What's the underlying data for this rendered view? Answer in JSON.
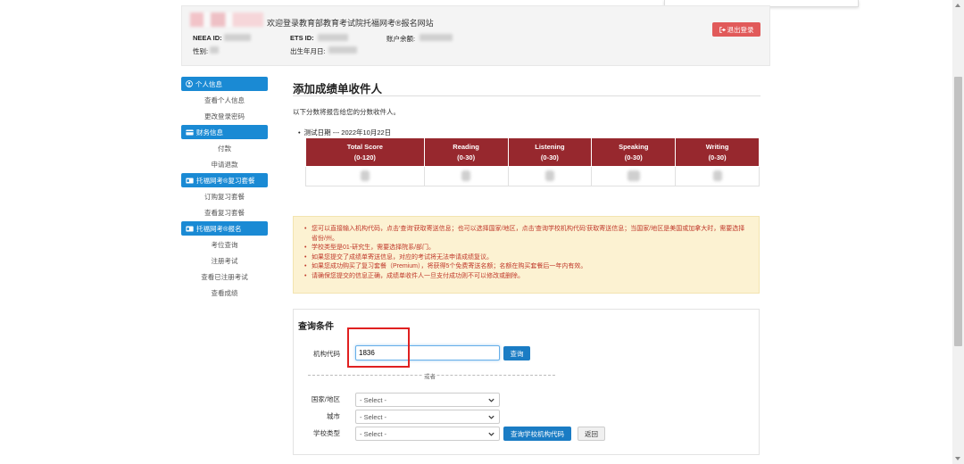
{
  "header": {
    "welcome": "欢迎登录教育部教育考试院托福网考®报名网站",
    "neea_id_label": "NEEA ID:",
    "ets_id_label": "ETS ID:",
    "balance_label": "账户余额:",
    "gender_label": "性别:",
    "dob_label": "出生年月日:",
    "logout_label": "退出登录"
  },
  "sidebar": {
    "sections": [
      {
        "title": "个人信息",
        "items": [
          "查看个人信息",
          "更改登录密码"
        ]
      },
      {
        "title": "财务信息",
        "items": [
          "付款",
          "申请退款"
        ]
      },
      {
        "title": "托福网考®复习套餐",
        "items": [
          "订购复习套餐",
          "查看复习套餐"
        ]
      },
      {
        "title": "托福网考®报名",
        "items": [
          "考位查询",
          "注册考试",
          "查看已注册考试",
          "查看成绩"
        ]
      }
    ]
  },
  "main": {
    "title": "添加成绩单收件人",
    "intro": "以下分数将报告给您的分数收件人。",
    "test_date": "测试日期 --- 2022年10月22日",
    "score_headers": [
      {
        "name": "Total Score",
        "range": "(0-120)"
      },
      {
        "name": "Reading",
        "range": "(0-30)"
      },
      {
        "name": "Listening",
        "range": "(0-30)"
      },
      {
        "name": "Speaking",
        "range": "(0-30)"
      },
      {
        "name": "Writing",
        "range": "(0-30)"
      }
    ],
    "notices": [
      "您可以直接输入机构代码，点击'查询'获取寄送信息；也可以选择国家/地区，点击'查询学校机构代码'获取寄送信息；当国家/地区是美国或加拿大时，需要选择省份/州。",
      "学校类型是01-研究生，需要选择院系/部门。",
      "如果您提交了成绩单寄送信息，对应的考试将无法申请成绩复议。",
      "如果您成功购买了复习套餐（Premium），将获得5个免费寄送名额；名额在购买套餐后一年内有效。",
      "请确保您提交的信息正确，成绩单收件人一旦支付成功则不可以修改或删除。"
    ]
  },
  "query": {
    "title": "查询条件",
    "code_label": "机构代码",
    "code_value": "1836",
    "query_button": "查询",
    "or_text": "或者",
    "country_label": "国家/地区",
    "city_label": "城市",
    "school_type_label": "学校类型",
    "select_placeholder": "- Select -",
    "query_school_button": "查询学校机构代码",
    "back_button": "返回"
  },
  "colors": {
    "accent_blue": "#1a8ad4",
    "table_header": "#97282e",
    "logout_red": "#e15a5a",
    "notice_bg": "#fcf2d2",
    "notice_text": "#c0392b",
    "highlight_box": "#e02020"
  }
}
